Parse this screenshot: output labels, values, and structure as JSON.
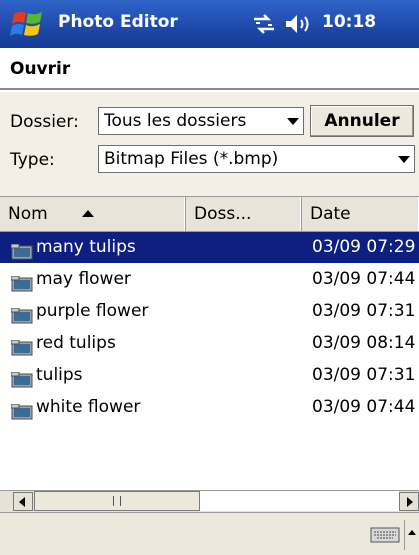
{
  "titlebar": {
    "app_title": "Photo Editor",
    "time": "10:18",
    "icons": [
      "windows-start-icon",
      "connectivity-icon",
      "volume-icon"
    ]
  },
  "header": {
    "title": "Ouvrir"
  },
  "form": {
    "folder_label": "Dossier:",
    "folder_value": "Tous les dossiers",
    "cancel_label": "Annuler",
    "type_label": "Type:",
    "type_value": "Bitmap Files (*.bmp)"
  },
  "columns": {
    "name": "Nom",
    "folder": "Doss...",
    "date": "Date"
  },
  "files": [
    {
      "name": "many tulips",
      "date": "03/09 07:29",
      "selected": true
    },
    {
      "name": "may flower",
      "date": "03/09 07:44",
      "selected": false
    },
    {
      "name": "purple flower",
      "date": "03/09 07:31",
      "selected": false
    },
    {
      "name": "red tulips",
      "date": "03/09 08:14",
      "selected": false
    },
    {
      "name": "tulips",
      "date": "03/09 07:31",
      "selected": false
    },
    {
      "name": "white flower",
      "date": "03/09 07:44",
      "selected": false
    }
  ],
  "colors": {
    "titlebar": "#1d48a8",
    "selection": "#0d1f80",
    "panel": "#f3efe6"
  }
}
